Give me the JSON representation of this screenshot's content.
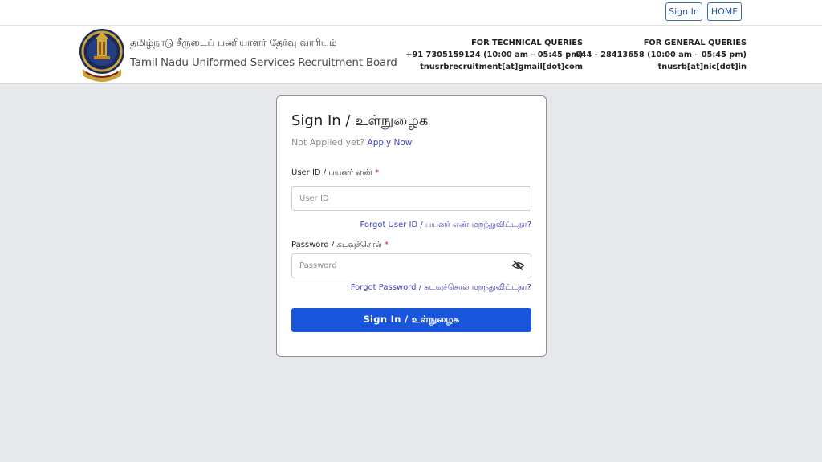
{
  "topbar": {
    "signin_label": "Sign In",
    "home_label": "HOME"
  },
  "header": {
    "org_name_tamil": "தமிழ்நாடு சீருடைப் பணியாளர் தேர்வு வாரியம்",
    "org_name_english": "Tamil Nadu Uniformed Services Recruitment Board",
    "technical": {
      "title": "FOR TECHNICAL QUERIES",
      "phone": "+91 7305159124  (10:00 am – 05:45 pm)",
      "email": "tnusrbrecruitment[at]gmail[dot]com"
    },
    "general": {
      "title": "FOR GENERAL QUERIES",
      "phone": "044 - 28413658  (10:00 am – 05:45 pm)",
      "email": "tnusrb[at]nic[dot]in"
    }
  },
  "form": {
    "title": "Sign In / உள்நுழைக",
    "not_applied_text": "Not Applied yet?",
    "apply_link": "Apply Now",
    "user_id_label": "User ID / பயனர் எண்",
    "user_id_placeholder": "User ID",
    "user_id_value": "",
    "forgot_user_id": "Forgot User ID / பயனர் எண் மறந்துவிட்டதா?",
    "password_label": "Password / கடவுச்சொல்",
    "password_placeholder": "Password",
    "password_value": "",
    "forgot_password": "Forgot Password / கடவுச்சொல் மறந்துவிட்டதா?",
    "required_marker": "*",
    "submit_label": "Sign In / உள்நுழைக"
  },
  "icons": {
    "emblem": "tn-government-emblem-icon",
    "password_toggle": "eye-slash-icon"
  },
  "colors": {
    "primary": "#1a56db",
    "link": "#3b3fb5",
    "required": "#d9262e",
    "page_background": "#e8e9ec"
  }
}
